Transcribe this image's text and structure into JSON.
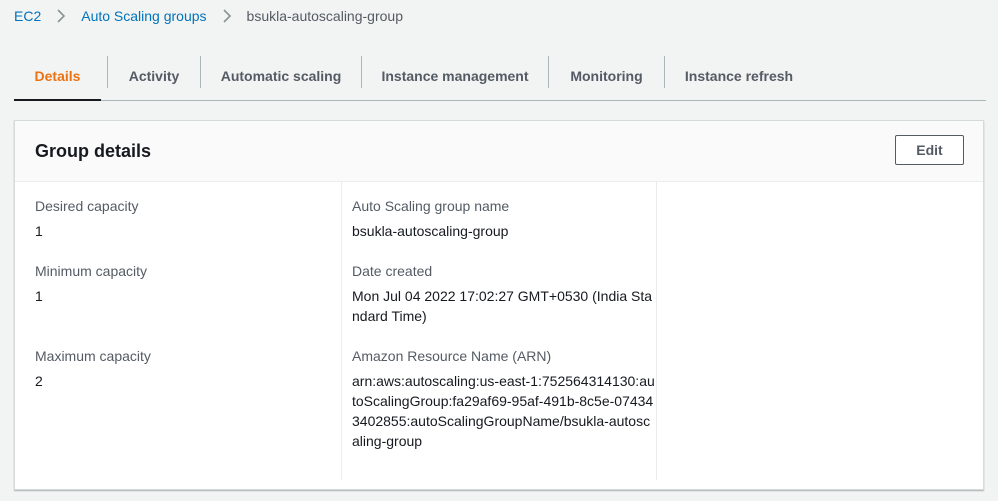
{
  "breadcrumb": {
    "items": [
      {
        "label": "EC2"
      },
      {
        "label": "Auto Scaling groups"
      },
      {
        "label": "bsukla-autoscaling-group"
      }
    ]
  },
  "tabs": [
    {
      "label": "Details",
      "active": true
    },
    {
      "label": "Activity"
    },
    {
      "label": "Automatic scaling"
    },
    {
      "label": "Instance management"
    },
    {
      "label": "Monitoring"
    },
    {
      "label": "Instance refresh"
    }
  ],
  "panel": {
    "title": "Group details",
    "edit_label": "Edit"
  },
  "details": {
    "desired_capacity": {
      "label": "Desired capacity",
      "value": "1"
    },
    "minimum_capacity": {
      "label": "Minimum capacity",
      "value": "1"
    },
    "maximum_capacity": {
      "label": "Maximum capacity",
      "value": "2"
    },
    "group_name": {
      "label": "Auto Scaling group name",
      "value": "bsukla-autoscaling-group"
    },
    "date_created": {
      "label": "Date created",
      "value": "Mon Jul 04 2022 17:02:27 GMT+0530 (India Standard Time)"
    },
    "arn": {
      "label": "Amazon Resource Name (ARN)",
      "value": "arn:aws:autoscaling:us-east-1:752564314130:autoScalingGroup:fa29af69-95af-491b-8c5e-074343402855:autoScalingGroupName/bsukla-autoscaling-group"
    }
  },
  "colors": {
    "link": "#0073bb",
    "active_tab": "#ec7211",
    "text": "#16191f",
    "muted": "#545b64"
  },
  "icons": {
    "breadcrumb_separator": "chevron-right-icon"
  }
}
